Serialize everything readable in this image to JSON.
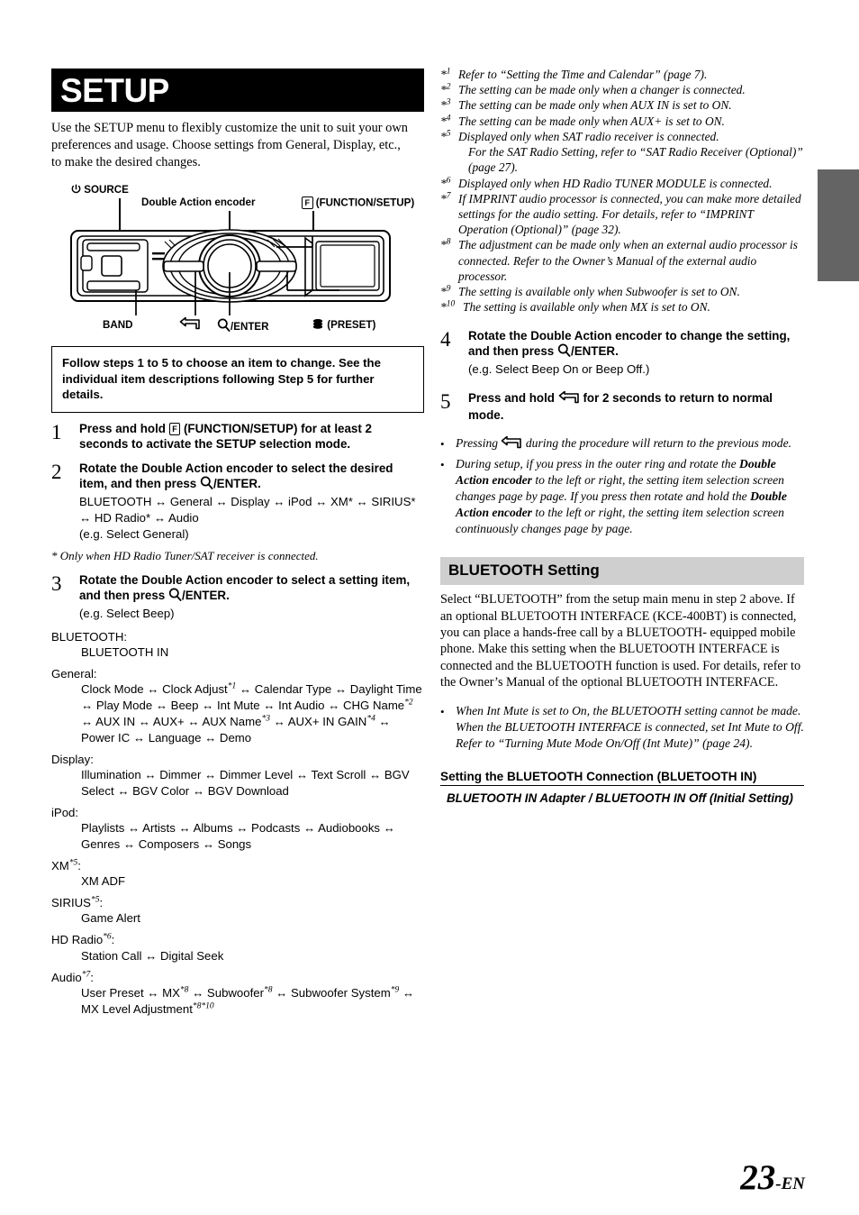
{
  "page": {
    "number": "23",
    "suffix": "-EN",
    "edge_tab_color": "#646464",
    "section_header_bg": "#cfcfcf"
  },
  "title": {
    "banner_text": "SETUP",
    "banner_bg": "#000000",
    "banner_color": "#ffffff"
  },
  "intro": "Use the SETUP menu to flexibly customize the unit to suit your own preferences and usage. Choose settings from General, Display, etc., to make the desired changes.",
  "device": {
    "labels": {
      "source": "SOURCE",
      "encoder": "Double Action encoder",
      "function_setup": "(FUNCTION/SETUP)",
      "function_key": "F",
      "band": "BAND",
      "enter": "/ENTER",
      "preset": "(PRESET)"
    }
  },
  "callout": "Follow steps 1 to 5 to choose an item to change. See the individual item descriptions following Step 5 for further details.",
  "steps": [
    {
      "num": "1",
      "head_pre": "Press and hold ",
      "head_key": "F",
      "head_post": " (FUNCTION/SETUP) for at least 2 seconds to activate the SETUP selection mode."
    },
    {
      "num": "2",
      "head_a": "Rotate the ",
      "head_b": "Double Action encoder",
      "head_c": " to select the desired item, and then press ",
      "head_d": "/ENTER.",
      "chain": "BLUETOOTH ↔ General ↔ Display ↔ iPod ↔ XM* ↔ SIRIUS* ↔ HD Radio* ↔ Audio",
      "example": "(e.g. Select General)",
      "footnote": "* Only when HD Radio Tuner/SAT receiver is connected."
    },
    {
      "num": "3",
      "head_a": "Rotate the ",
      "head_b": "Double Action encoder",
      "head_c": " to select a setting item, and then press ",
      "head_d": "/ENTER.",
      "example": "(e.g. Select Beep)"
    }
  ],
  "menu_tree": [
    {
      "category": "BLUETOOTH:",
      "cat_sup": "",
      "items": "BLUETOOTH IN"
    },
    {
      "category": "General:",
      "cat_sup": "",
      "items_html": "Clock Mode ↔ Clock Adjust*1 ↔ Calendar Type ↔ Daylight Time ↔ Play Mode ↔ Beep ↔ Int Mute ↔ Int Audio ↔ CHG Name*2 ↔ AUX IN ↔ AUX+ ↔ AUX Name*3 ↔ AUX+ IN GAIN*4 ↔ Power IC ↔ Language ↔ Demo"
    },
    {
      "category": "Display:",
      "cat_sup": "",
      "items_html": "Illumination ↔ Dimmer ↔ Dimmer Level ↔ Text Scroll ↔ BGV Select ↔ BGV Color ↔ BGV Download"
    },
    {
      "category": "iPod:",
      "cat_sup": "",
      "items_html": "Playlists ↔ Artists ↔ Albums ↔ Podcasts ↔ Audiobooks ↔ Genres ↔ Composers ↔ Songs"
    },
    {
      "category": "XM",
      "cat_sup": "*5",
      "cat_tail": ":",
      "items_html": "XM ADF"
    },
    {
      "category": "SIRIUS",
      "cat_sup": "*5",
      "cat_tail": ":",
      "items_html": "Game Alert"
    },
    {
      "category": "HD Radio",
      "cat_sup": "*6",
      "cat_tail": ":",
      "items_html": "Station Call ↔ Digital Seek"
    },
    {
      "category": "Audio",
      "cat_sup": "*7",
      "cat_tail": ":",
      "items_html": "User Preset ↔ MX*8 ↔ Subwoofer*8 ↔ Subwoofer System*9 ↔ MX Level Adjustment*8*10"
    }
  ],
  "footnotes": [
    {
      "mark": "*1",
      "lines": [
        "Refer to “Setting the Time and Calendar” (page 7)."
      ]
    },
    {
      "mark": "*2",
      "lines": [
        "The setting can be made only when a changer is connected."
      ]
    },
    {
      "mark": "*3",
      "lines": [
        "The setting can be made only when AUX IN is set to ON."
      ]
    },
    {
      "mark": "*4",
      "lines": [
        "The setting can be made only when AUX+ is set to ON."
      ]
    },
    {
      "mark": "*5",
      "lines": [
        "Displayed only when SAT radio receiver is connected.",
        "For the SAT Radio Setting, refer to “SAT Radio Receiver (Optional)” (page 27)."
      ]
    },
    {
      "mark": "*6",
      "lines": [
        "Displayed only when HD Radio TUNER MODULE is connected."
      ]
    },
    {
      "mark": "*7",
      "lines": [
        "If IMPRINT audio processor is connected, you can make more detailed settings for the audio setting. For details, refer to “IMPRINT Operation (Optional)” (page 32)."
      ]
    },
    {
      "mark": "*8",
      "lines": [
        "The adjustment can be made only when an external audio processor is connected. Refer to the Owner’s Manual of the external audio processor."
      ]
    },
    {
      "mark": "*9",
      "lines": [
        "The setting is available only when Subwoofer is set to ON."
      ]
    },
    {
      "mark": "*10",
      "lines": [
        "The setting is available only when MX is set to ON."
      ]
    }
  ],
  "right_steps": [
    {
      "num": "4",
      "head_a": "Rotate the ",
      "head_b": "Double Action encoder",
      "head_c": " to change the setting, and then press ",
      "head_d": "/ENTER.",
      "example": "(e.g. Select Beep On or Beep Off.)"
    },
    {
      "num": "5",
      "head_a": "Press and hold ",
      "head_c": " for 2 seconds to return to normal mode."
    }
  ],
  "right_bullets": [
    {
      "pre": "Pressing ",
      "post": " during the procedure will return to the previous mode."
    },
    {
      "t1": "During setup, if you press in the outer ring and rotate the ",
      "b1": "Double Action encoder",
      "t2": " to the left or right, the setting item selection screen changes page by page. If you press then rotate and hold the ",
      "b2": "Double Action encoder",
      "t3": " to the left or right, the setting item selection screen continuously changes page by page."
    }
  ],
  "bluetooth": {
    "section_title": "BLUETOOTH Setting",
    "body": "Select “BLUETOOTH” from the setup main menu in step 2 above. If an optional BLUETOOTH INTERFACE (KCE-400BT) is connected, you can place a hands-free call by a BLUETOOTH- equipped mobile phone. Make this setting when the BLUETOOTH INTERFACE is connected and the BLUETOOTH function is used. For details, refer to the Owner’s Manual of the optional BLUETOOTH INTERFACE.",
    "bullet": "When Int Mute is set to On, the BLUETOOTH setting cannot be made. When the BLUETOOTH INTERFACE is connected, set Int Mute to Off. Refer to “Turning Mute Mode On/Off (Int Mute)” (page 24).",
    "sub_head": "Setting the BLUETOOTH Connection (BLUETOOTH IN)",
    "sub_value": "BLUETOOTH IN Adapter / BLUETOOTH IN Off (Initial Setting)"
  }
}
